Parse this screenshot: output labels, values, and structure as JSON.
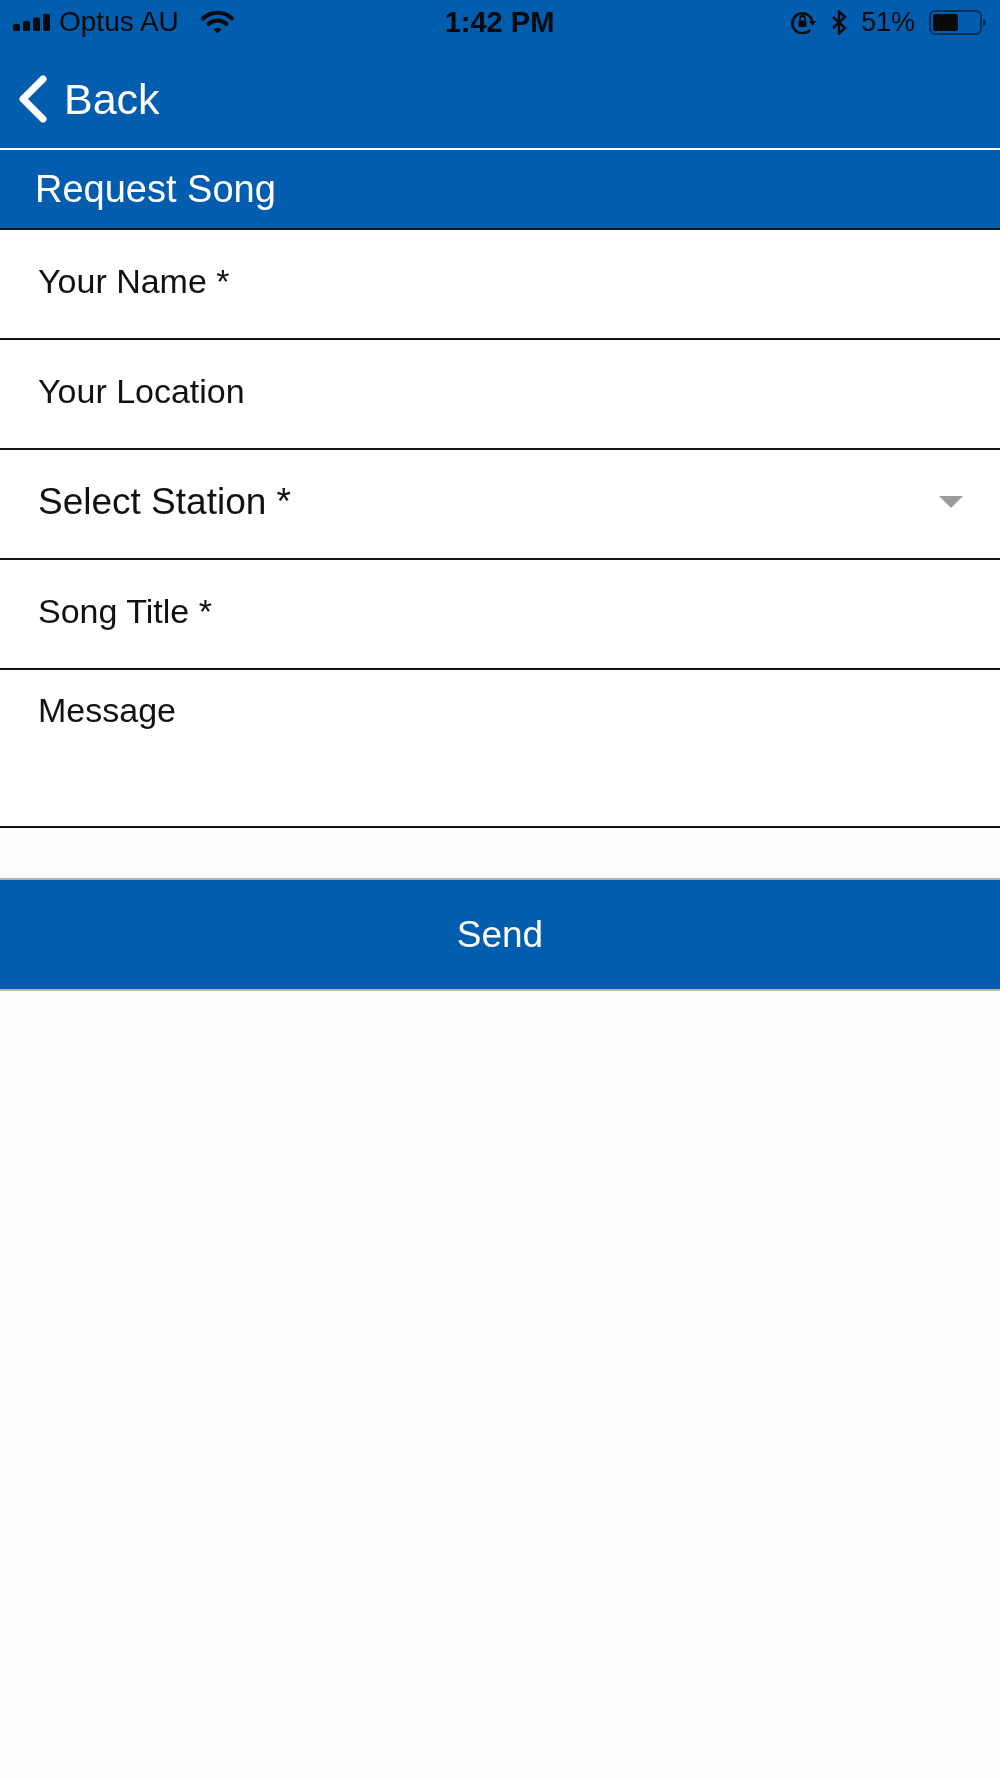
{
  "status_bar": {
    "carrier": "Optus AU",
    "time": "1:42 PM",
    "battery_percent": "51%"
  },
  "nav_bar": {
    "back_label": "Back"
  },
  "header": {
    "title": "Request Song"
  },
  "form": {
    "fields": [
      {
        "kind": "text",
        "placeholder": "Your Name *"
      },
      {
        "kind": "text",
        "placeholder": "Your Location"
      },
      {
        "kind": "select",
        "placeholder": "Select Station *"
      },
      {
        "kind": "text",
        "placeholder": "Song Title *"
      },
      {
        "kind": "textarea",
        "placeholder": "Message"
      }
    ]
  },
  "send_button": {
    "label": "Send"
  }
}
